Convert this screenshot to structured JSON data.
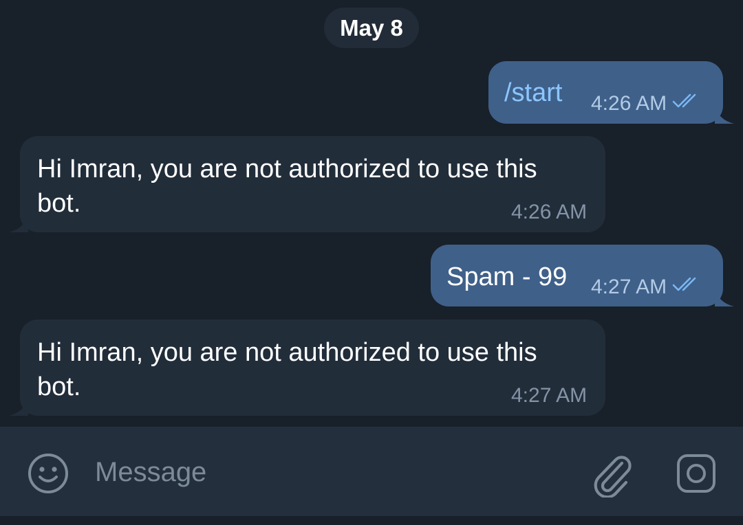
{
  "chat": {
    "date_separator": "May 8",
    "messages": [
      {
        "direction": "out",
        "text": "/start",
        "time": "4:26 AM",
        "status": "read"
      },
      {
        "direction": "in",
        "line1": "Hi Imran, you are not authorized to use this",
        "line2": "bot.",
        "time": "4:26 AM"
      },
      {
        "direction": "out",
        "text": "Spam - 99",
        "time": "4:27 AM",
        "status": "read"
      },
      {
        "direction": "in",
        "line1": "Hi Imran, you are not authorized to use this",
        "line2": "bot.",
        "time": "4:27 AM"
      }
    ]
  },
  "composer": {
    "placeholder": "Message",
    "emoji_icon": "smiley-icon",
    "attach_icon": "paperclip-icon",
    "camera_icon": "camera-icon"
  },
  "colors": {
    "background": "#18202a",
    "outgoing_bubble": "#3f6089",
    "incoming_bubble": "#222d3a",
    "command_text": "#8cc6ff",
    "read_check": "#7ab8f5"
  }
}
